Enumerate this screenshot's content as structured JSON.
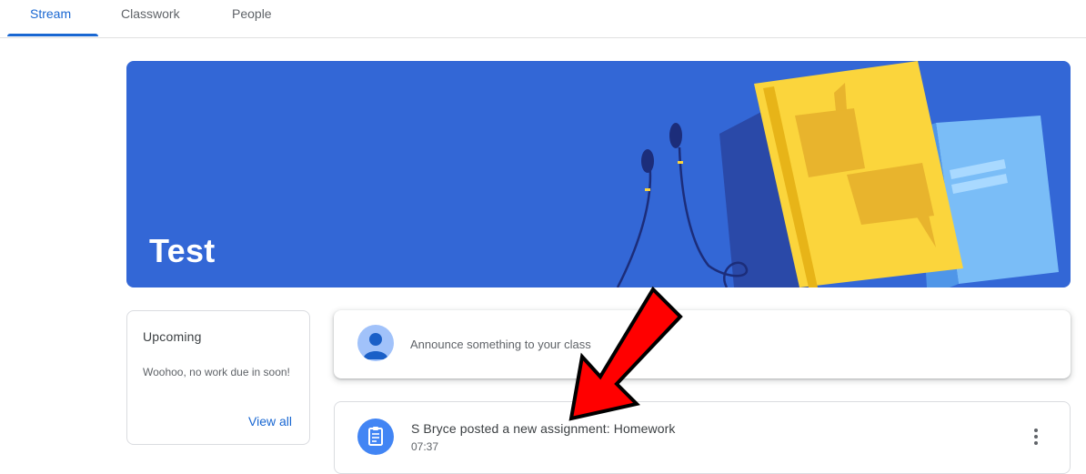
{
  "tabs": [
    {
      "label": "Stream",
      "active": true
    },
    {
      "label": "Classwork",
      "active": false
    },
    {
      "label": "People",
      "active": false
    }
  ],
  "banner": {
    "class_name": "Test",
    "color": "#3367d6"
  },
  "upcoming": {
    "title": "Upcoming",
    "message": "Woohoo, no work due in soon!",
    "view_all_label": "View all"
  },
  "announce": {
    "placeholder": "Announce something to your class"
  },
  "posts": [
    {
      "title": "S Bryce posted a new assignment: Homework",
      "time": "07:37",
      "icon": "assignment-icon"
    }
  ],
  "colors": {
    "accent": "#1967d2",
    "annotation_arrow": "#ff0000"
  }
}
